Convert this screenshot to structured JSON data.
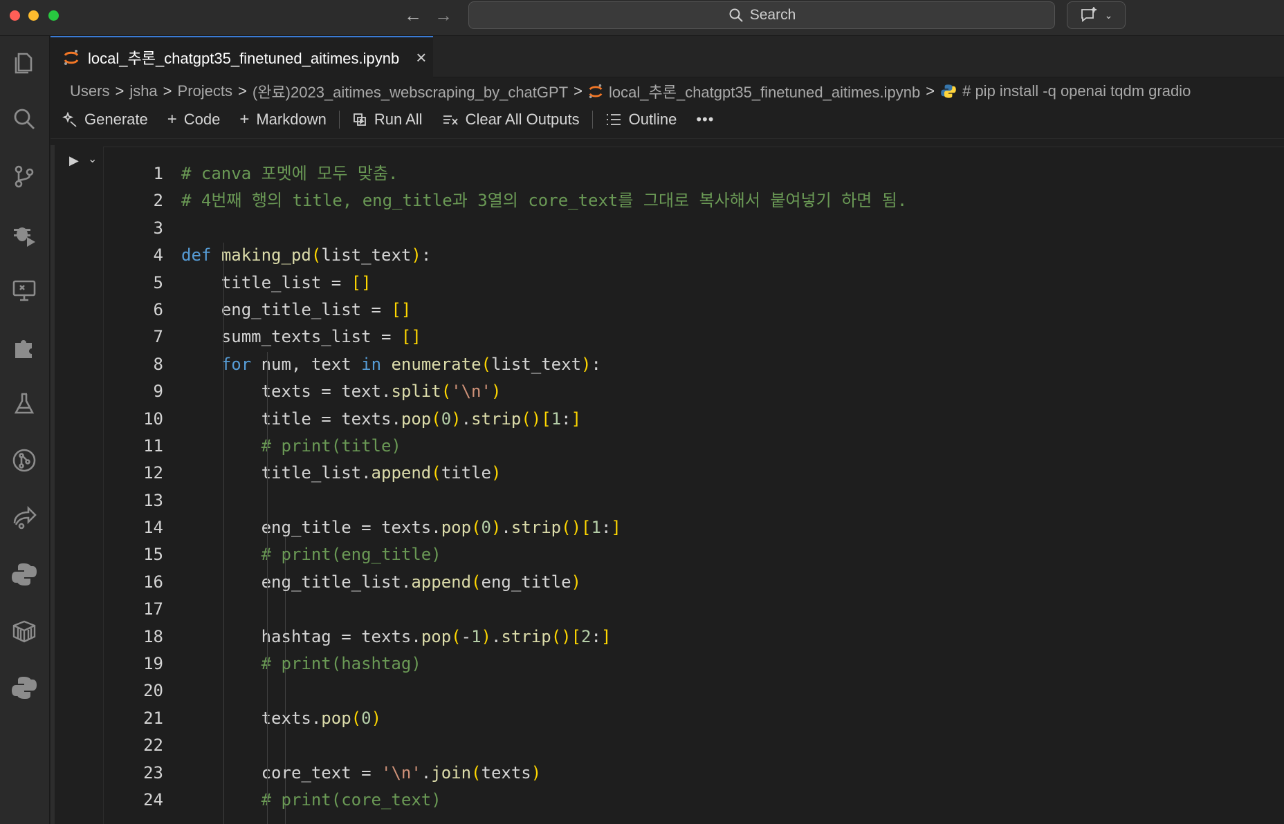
{
  "titlebar": {
    "search_placeholder": "Search",
    "back_icon": "arrow-left-icon",
    "forward_icon": "arrow-right-icon",
    "chat_icon": "chat-sparkle-icon"
  },
  "activity_bar": [
    {
      "name": "explorer-icon"
    },
    {
      "name": "search-icon"
    },
    {
      "name": "source-control-icon"
    },
    {
      "name": "run-debug-icon"
    },
    {
      "name": "remote-explorer-icon"
    },
    {
      "name": "extensions-icon"
    },
    {
      "name": "testing-icon"
    },
    {
      "name": "git-graph-icon"
    },
    {
      "name": "live-share-icon"
    },
    {
      "name": "python-icon"
    },
    {
      "name": "package-icon"
    },
    {
      "name": "python-env-icon"
    }
  ],
  "tab": {
    "label": "local_추론_chatgpt35_finetuned_aitimes.ipynb",
    "close": "×"
  },
  "breadcrumb": {
    "items": [
      "Users",
      "jsha",
      "Projects",
      "(완료)2023_aitimes_webscraping_by_chatGPT",
      "local_추론_chatgpt35_finetuned_aitimes.ipynb",
      "# pip install -q openai tqdm gradio"
    ],
    "separator": ">"
  },
  "toolbar": {
    "generate": "Generate",
    "code": "Code",
    "markdown": "Markdown",
    "run_all": "Run All",
    "clear_all_outputs": "Clear All Outputs",
    "outline": "Outline",
    "more": "•••"
  },
  "editor": {
    "line_numbers": [
      "1",
      "2",
      "3",
      "4",
      "5",
      "6",
      "7",
      "8",
      "9",
      "10",
      "11",
      "12",
      "13",
      "14",
      "15",
      "16",
      "17",
      "18",
      "19",
      "20",
      "21",
      "22",
      "23",
      "24"
    ],
    "lines": [
      "# canva 포멧에 모두 맞춤.",
      "# 4번째 행의 title, eng_title과 3열의 core_text를 그대로 복사해서 붙여넣기 하면 됨.",
      "",
      "def making_pd(list_text):",
      "    title_list = []",
      "    eng_title_list = []",
      "    summ_texts_list = []",
      "    for num, text in enumerate(list_text):",
      "        texts = text.split('\\n')",
      "        title = texts.pop(0).strip()[1:]",
      "        # print(title)",
      "        title_list.append(title)",
      "",
      "        eng_title = texts.pop(0).strip()[1:]",
      "        # print(eng_title)",
      "        eng_title_list.append(eng_title)",
      "",
      "        hashtag = texts.pop(-1).strip()[2:]",
      "        # print(hashtag)",
      "",
      "        texts.pop(0)",
      "",
      "        core_text = '\\n'.join(texts)",
      "        # print(core_text)"
    ]
  },
  "colors": {
    "comment": "#6a9955",
    "keyword": "#569cd6",
    "function": "#dcdcaa",
    "string": "#ce9178",
    "number": "#b5cea8",
    "bracket": "#ffd700",
    "active_tab_border": "#3a7bd5"
  }
}
